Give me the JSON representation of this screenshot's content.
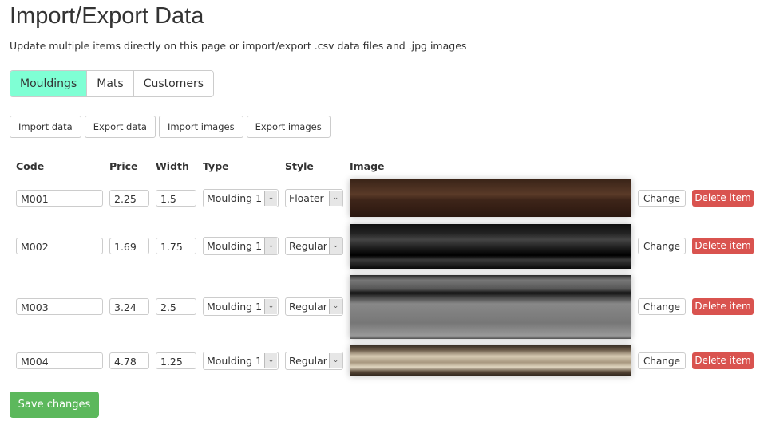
{
  "title": "Import/Export Data",
  "subtitle": "Update multiple items directly on this page or import/export .csv data files and .jpg images",
  "tabs": [
    {
      "label": "Mouldings",
      "active": true
    },
    {
      "label": "Mats"
    },
    {
      "label": "Customers"
    }
  ],
  "actions": [
    "Import data",
    "Export data",
    "Import images",
    "Export images"
  ],
  "headers": {
    "code": "Code",
    "price": "Price",
    "width": "Width",
    "type": "Type",
    "style": "Style",
    "image": "Image"
  },
  "rows": [
    {
      "code": "M001",
      "price": "2.25",
      "width": "1.5",
      "type": "Moulding 1",
      "style": "Floater"
    },
    {
      "code": "M002",
      "price": "1.69",
      "width": "1.75",
      "type": "Moulding 1",
      "style": "Regular"
    },
    {
      "code": "M003",
      "price": "3.24",
      "width": "2.5",
      "type": "Moulding 1",
      "style": "Regular"
    },
    {
      "code": "M004",
      "price": "4.78",
      "width": "1.25",
      "type": "Moulding 1",
      "style": "Regular"
    }
  ],
  "change_label": "Change",
  "delete_label": "Delete item",
  "save_label": "Save changes",
  "colors": {
    "active_tab": "#7fffd4",
    "delete": "#d9534f",
    "save": "#5cb85c"
  }
}
